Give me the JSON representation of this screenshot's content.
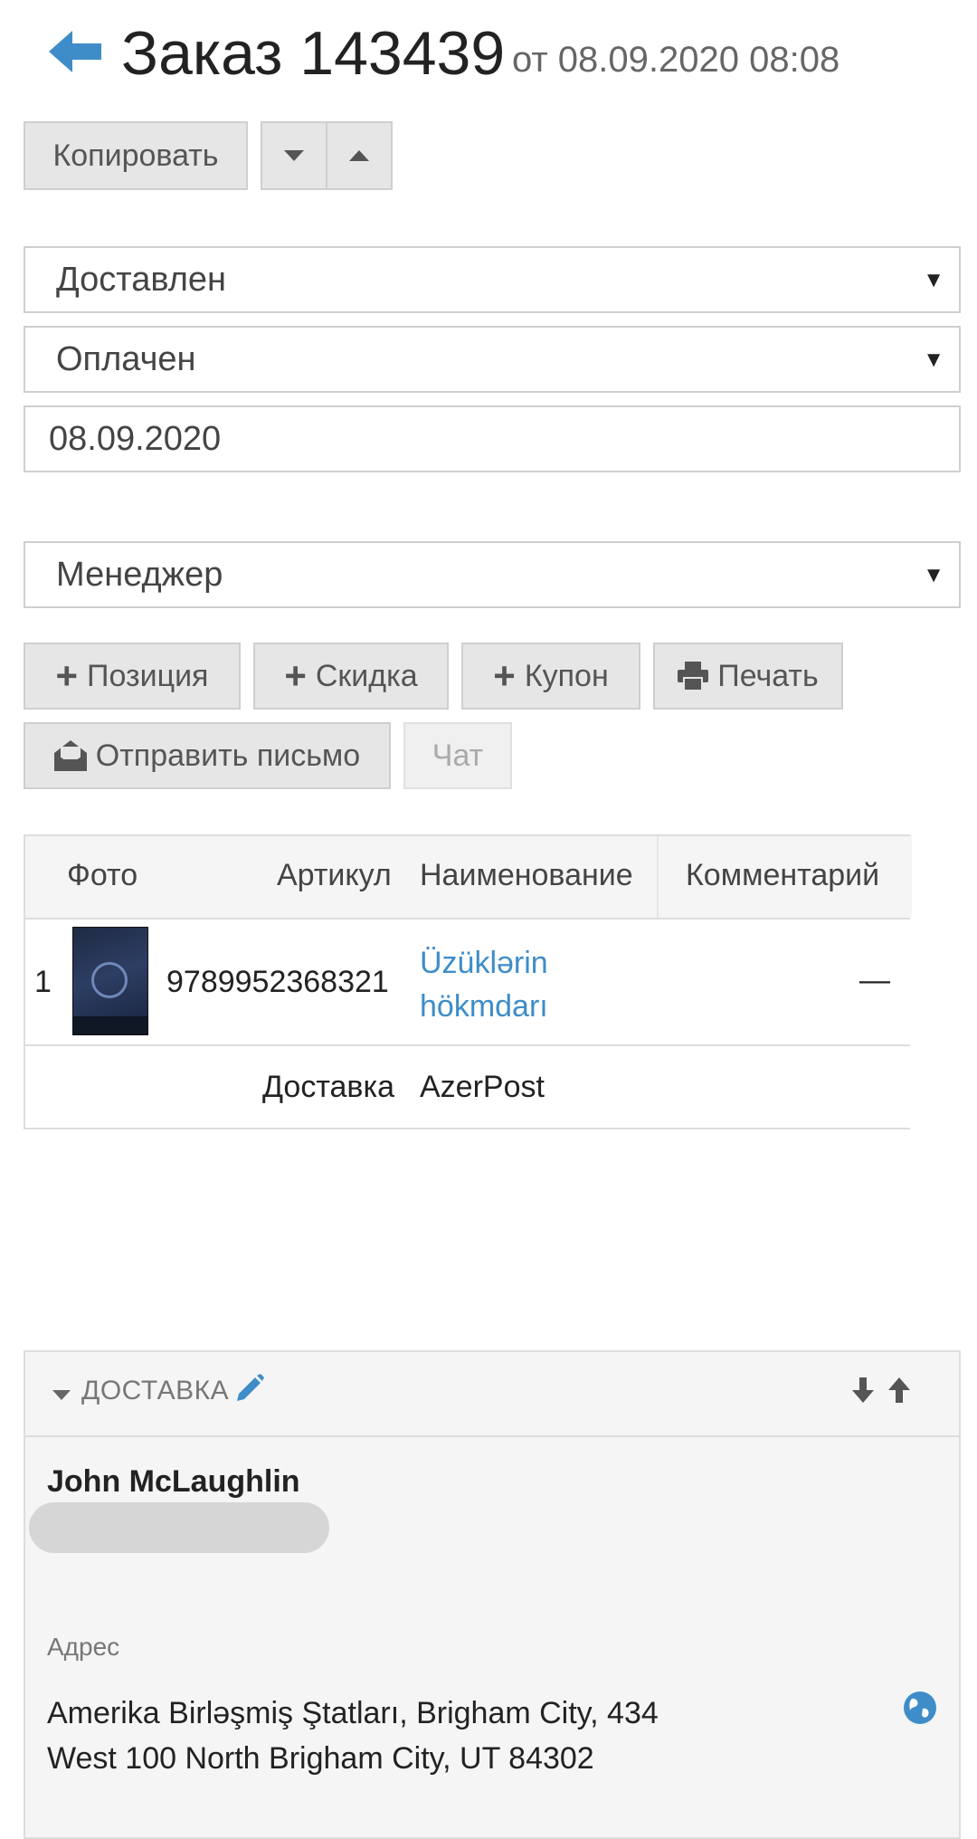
{
  "header": {
    "title": "Заказ 143439",
    "date_text": "от 08.09.2020 08:08",
    "back_icon": "arrow-left-icon",
    "accent": "#3e8dc8"
  },
  "toolbar": {
    "copy_label": "Копировать",
    "down_icon": "caret-down-icon",
    "up_icon": "caret-up-icon"
  },
  "fields": {
    "status_value": "Доставлен",
    "payment_value": "Оплачен",
    "date_value": "08.09.2020",
    "manager_value": "Менеджер"
  },
  "actions": {
    "position_label": "Позиция",
    "discount_label": "Скидка",
    "coupon_label": "Купон",
    "print_label": "Печать",
    "send_mail_label": "Отправить письмо",
    "chat_label": "Чат"
  },
  "table": {
    "headers": [
      "Фото",
      "Артикул",
      "Наименование",
      "Комментарий"
    ],
    "rows": [
      {
        "index": "1",
        "article": "9789952368321",
        "name_line1": "Üzüklərin",
        "name_line2": "hökmdarı",
        "comment": "—"
      }
    ],
    "delivery_row": {
      "label": "Доставка",
      "value": "AzerPost"
    }
  },
  "delivery_panel": {
    "title": "ДОСТАВКА",
    "customer_name": "John McLaughlin",
    "address_label": "Адрес",
    "address_line1": "Amerika Birləşmiş Ştatları, Brigham City, 434",
    "address_line2": "West 100 North Brigham City, UT 84302"
  }
}
